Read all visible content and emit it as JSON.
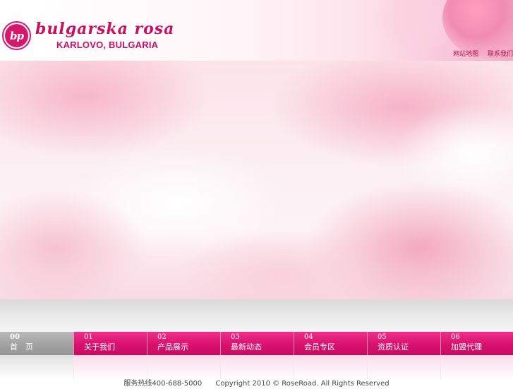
{
  "header": {
    "logo_mark": "bp",
    "logo_script": "bulgarska rosa",
    "logo_sub": "KARLOVO, BULGARIA",
    "top_links": [
      "网站地图",
      "联系我们"
    ]
  },
  "nav": {
    "items": [
      {
        "num": "00",
        "label": "首　页",
        "active": true
      },
      {
        "num": "01",
        "label": "关于我们",
        "active": false
      },
      {
        "num": "02",
        "label": "产品展示",
        "active": false
      },
      {
        "num": "03",
        "label": "最新动态",
        "active": false
      },
      {
        "num": "04",
        "label": "会员专区",
        "active": false
      },
      {
        "num": "05",
        "label": "资质认证",
        "active": false
      },
      {
        "num": "06",
        "label": "加盟代理",
        "active": false
      }
    ]
  },
  "footer": {
    "hotline": "服务热线400-688-5000",
    "copyright": "Copyright 2010 © RoseRoad. All Rights Reserved"
  },
  "colors": {
    "brand": "#c8105f",
    "nav_pink": "#d9116f",
    "nav_active": "#a2a2a2"
  }
}
